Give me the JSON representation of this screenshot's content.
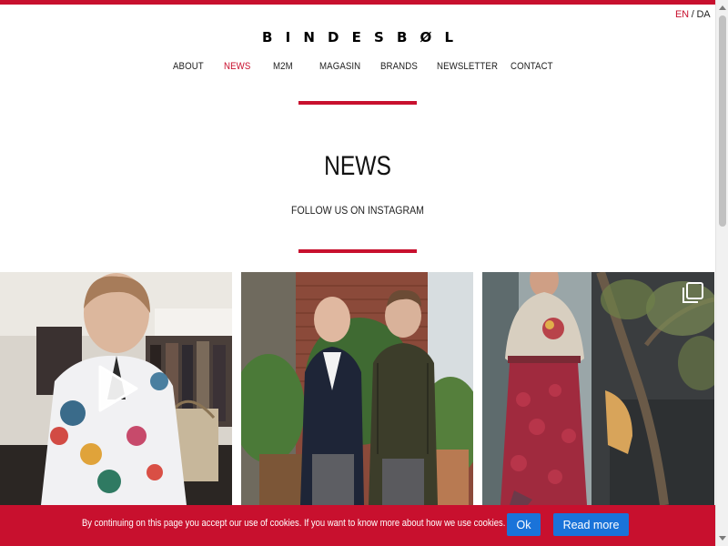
{
  "language": {
    "active": "EN",
    "separator": "/",
    "other": "DA"
  },
  "brand": {
    "logo_letters": [
      "B",
      "I",
      "N",
      "D",
      "E",
      "S",
      "B",
      "Ø",
      "L"
    ]
  },
  "nav": {
    "items": [
      {
        "label": "ABOUT",
        "active": false
      },
      {
        "label": "NEWS",
        "active": true
      },
      {
        "label": "M2M",
        "active": false
      },
      {
        "label": "MAGASIN",
        "active": false
      },
      {
        "label": "BRANDS",
        "active": false
      },
      {
        "label": "NEWSLETTER",
        "active": false
      },
      {
        "label": "CONTACT",
        "active": false
      }
    ]
  },
  "main": {
    "title": "NEWS",
    "subtitle": "FOLLOW US ON INSTAGRAM"
  },
  "instagram": {
    "posts": [
      {
        "type": "video",
        "icon": "play-icon"
      },
      {
        "type": "image"
      },
      {
        "type": "carousel",
        "icon": "multiple-images-icon"
      }
    ]
  },
  "cookie": {
    "text": "By continuing on this page you accept our use of cookies. If you want to know more about how we use cookies.",
    "ok_label": "Ok",
    "read_more_label": "Read more"
  },
  "colors": {
    "accent": "#c8102e",
    "button": "#1a73d9"
  }
}
